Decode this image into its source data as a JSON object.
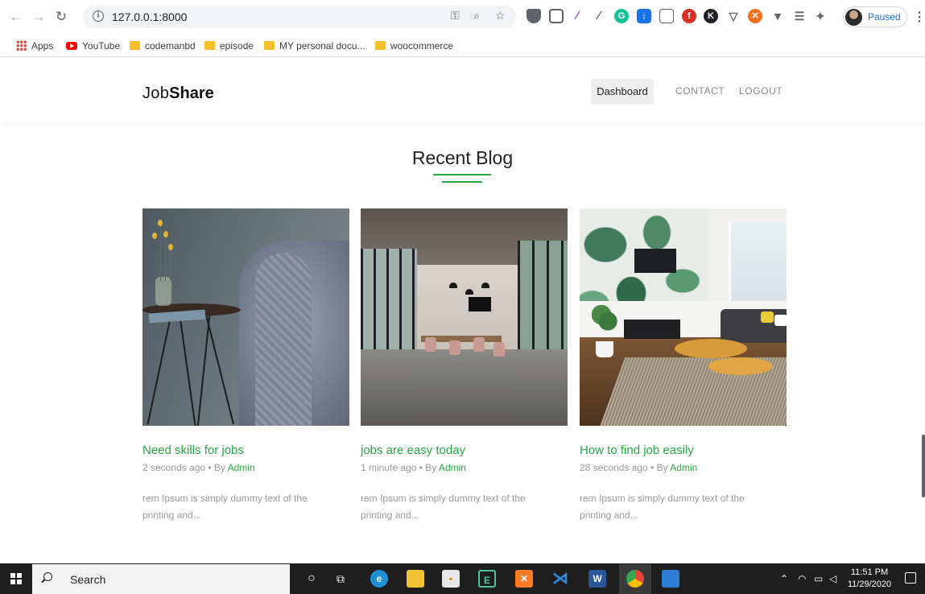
{
  "browser": {
    "url": "127.0.0.1:8000",
    "profile_status": "Paused",
    "bookmarks": [
      "Apps",
      "YouTube",
      "codemanbd",
      "episode",
      "MY personal docu...",
      "woocommerce"
    ]
  },
  "site": {
    "logo_light": "Job",
    "logo_bold": "Share",
    "nav": {
      "dashboard": "Dashboard",
      "contact": "CONTACT",
      "logout": "LOGOUT"
    },
    "section_title": "Recent Blog",
    "accent_color": "#28a745",
    "posts": [
      {
        "title": "Need skills for jobs",
        "time": "2 seconds ago",
        "by": "• By",
        "author": "Admin",
        "excerpt": "rem Ipsum is simply dummy text of the printing and..."
      },
      {
        "title": "jobs are easy today",
        "time": "1 minute ago",
        "by": "• By",
        "author": "Admin",
        "excerpt": "rem Ipsum is simply dummy text of the printing and..."
      },
      {
        "title": "How to find job easily",
        "time": "28 seconds ago",
        "by": "• By",
        "author": "Admin",
        "excerpt": "rem Ipsum is simply dummy text of the printing and..."
      }
    ]
  },
  "taskbar": {
    "search_label": "Search",
    "time": "11:51 PM",
    "date": "11/29/2020"
  }
}
